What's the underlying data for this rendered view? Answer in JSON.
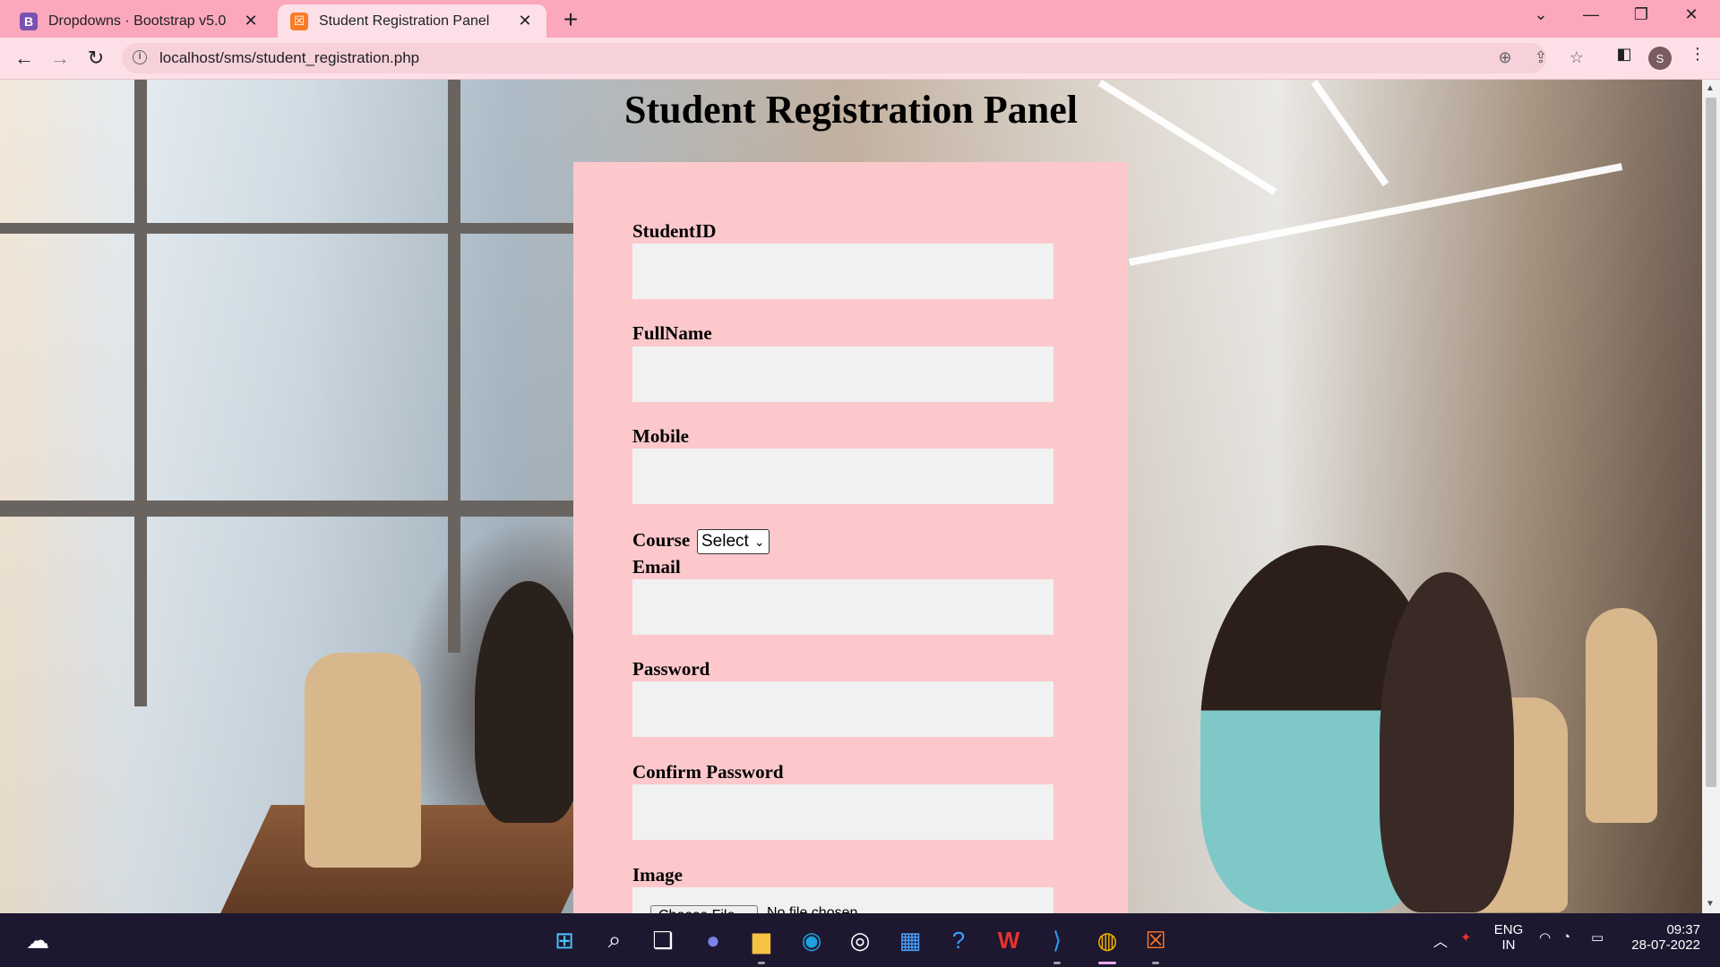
{
  "browser": {
    "tabs": [
      {
        "label": "Dropdowns · Bootstrap v5.0",
        "favicon": "B",
        "favicon_color": "#7952b3",
        "active": false
      },
      {
        "label": "Student Registration Panel",
        "favicon": "☒",
        "favicon_color": "#fb7a24",
        "active": true
      }
    ],
    "url": "localhost/sms/student_registration.php",
    "avatar_initial": "S"
  },
  "page": {
    "title": "Student Registration Panel",
    "panel_color": "#fcc8cc",
    "fields": {
      "student_id": {
        "label": "StudentID",
        "value": ""
      },
      "full_name": {
        "label": "FullName",
        "value": ""
      },
      "mobile": {
        "label": "Mobile",
        "value": ""
      },
      "course": {
        "label": "Course",
        "selected": "Select"
      },
      "email": {
        "label": "Email",
        "value": ""
      },
      "password": {
        "label": "Password",
        "value": ""
      },
      "confirm_password": {
        "label": "Confirm Password",
        "value": ""
      },
      "image": {
        "label": "Image",
        "button": "Choose File",
        "status": "No file chosen"
      }
    }
  },
  "taskbar": {
    "language": "ENG",
    "region": "IN",
    "time": "09:37",
    "date": "28-07-2022"
  }
}
